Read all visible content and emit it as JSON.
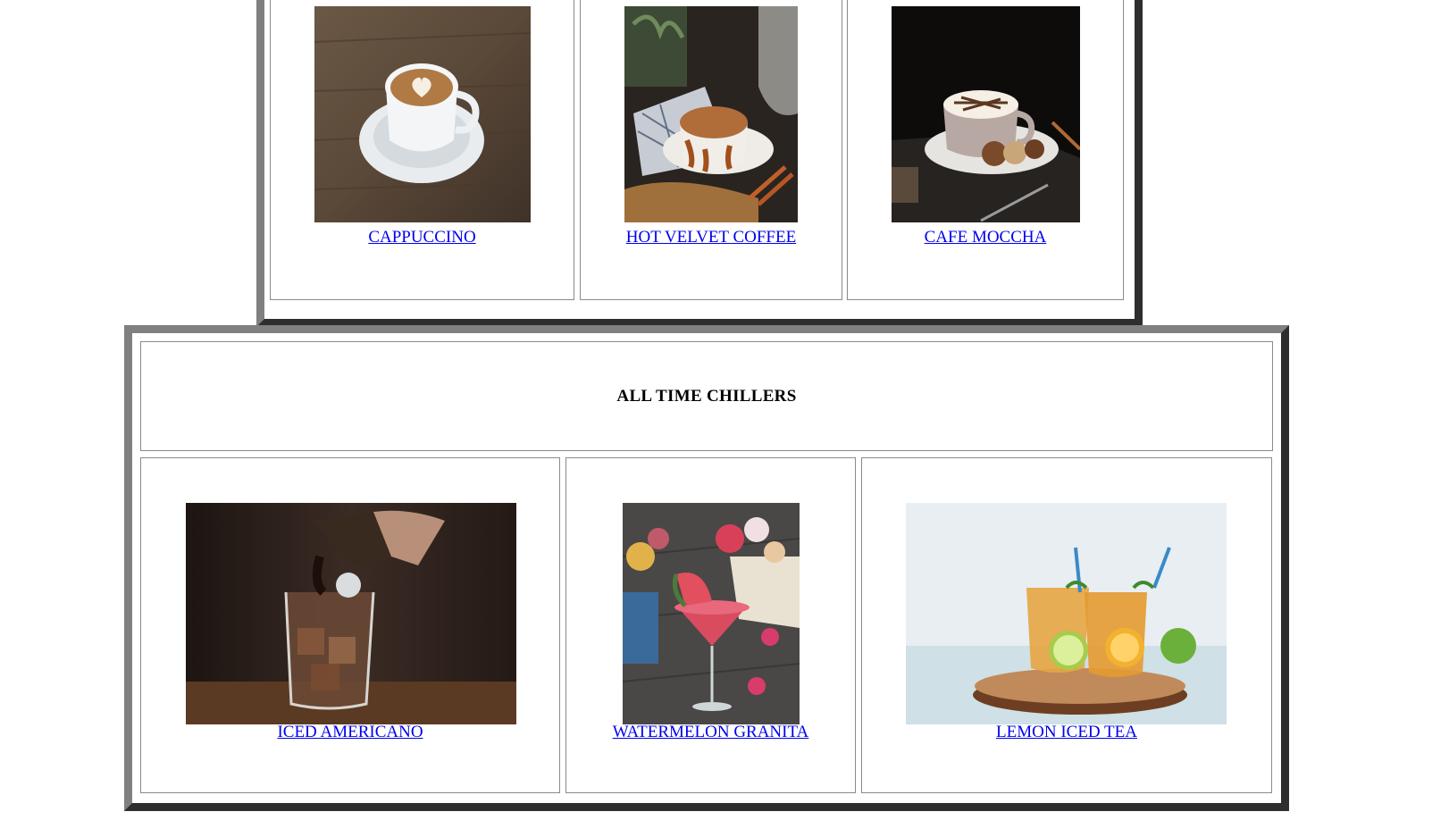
{
  "hot_section": {
    "items": [
      {
        "label": "CAPPUCCINO",
        "image_icon": "cappuccino-photo"
      },
      {
        "label": "HOT VELVET COFFEE",
        "image_icon": "hot-velvet-coffee-photo"
      },
      {
        "label": "CAFE MOCCHA",
        "image_icon": "cafe-moccha-photo"
      }
    ]
  },
  "chillers_section": {
    "heading": "ALL TIME CHILLERS",
    "items": [
      {
        "label": "ICED AMERICANO",
        "image_icon": "iced-americano-photo"
      },
      {
        "label": "WATERMELON GRANITA",
        "image_icon": "watermelon-granita-photo"
      },
      {
        "label": "LEMON ICED TEA",
        "image_icon": "lemon-iced-tea-photo"
      }
    ]
  },
  "colors": {
    "link": "#0000ee",
    "border_light": "#808080",
    "border_dark": "#2e2e2e"
  }
}
